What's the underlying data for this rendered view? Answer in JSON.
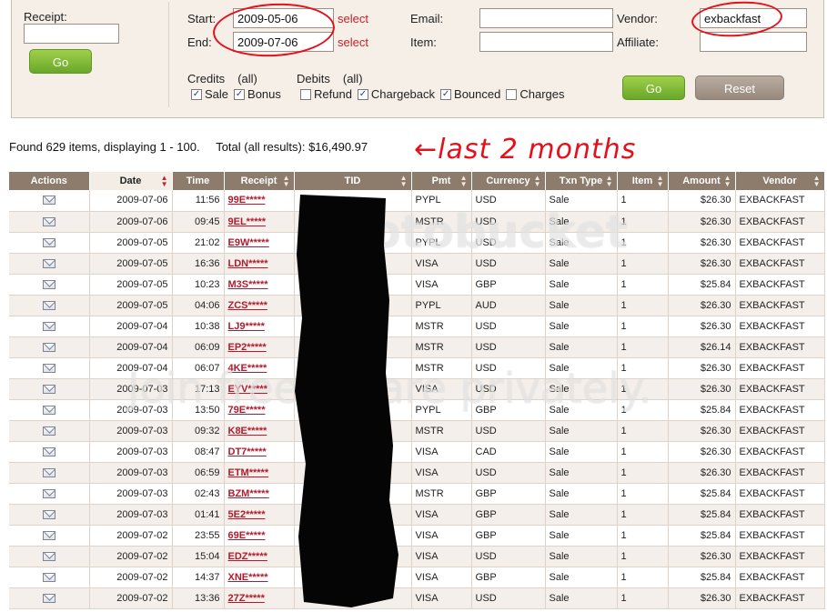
{
  "filters": {
    "receipt": {
      "label": "Receipt:",
      "value": ""
    },
    "start": {
      "label": "Start:",
      "value": "2009-05-06",
      "select_label": "select"
    },
    "end": {
      "label": "End:",
      "value": "2009-07-06",
      "select_label": "select"
    },
    "email": {
      "label": "Email:",
      "value": ""
    },
    "item": {
      "label": "Item:",
      "value": ""
    },
    "vendor": {
      "label": "Vendor:",
      "value": "exbackfast"
    },
    "affiliate": {
      "label": "Affiliate:",
      "value": ""
    },
    "go_left_label": "Go",
    "go_right_label": "Go",
    "reset_label": "Reset",
    "credits": {
      "title": "Credits",
      "all": "(all)",
      "options": [
        {
          "label": "Sale",
          "checked": true
        },
        {
          "label": "Bonus",
          "checked": true
        }
      ]
    },
    "debits": {
      "title": "Debits",
      "all": "(all)",
      "options": [
        {
          "label": "Refund",
          "checked": false
        },
        {
          "label": "Chargeback",
          "checked": true
        },
        {
          "label": "Bounced",
          "checked": true
        },
        {
          "label": "Charges",
          "checked": false
        }
      ]
    }
  },
  "summary": {
    "found": "Found 629 items, displaying 1 - 100.",
    "total": "Total (all results): $16,490.97"
  },
  "annotation": "←last 2 months",
  "watermark": {
    "logo": "photobucket",
    "tagline": "Join free. Share privately."
  },
  "table": {
    "headers": [
      "Actions",
      "Date",
      "Time",
      "Receipt",
      "TID",
      "Pmt",
      "Currency",
      "Txn Type",
      "Item",
      "Amount",
      "Vendor"
    ],
    "rows": [
      [
        "2009-07-06",
        "11:56",
        "99E*****",
        "PYPL",
        "USD",
        "Sale",
        "1",
        "$26.30",
        "EXBACKFAST"
      ],
      [
        "2009-07-06",
        "09:45",
        "9EL*****",
        "MSTR",
        "USD",
        "Sale",
        "1",
        "$26.30",
        "EXBACKFAST"
      ],
      [
        "2009-07-05",
        "21:02",
        "E9W*****",
        "PYPL",
        "USD",
        "Sale",
        "1",
        "$26.30",
        "EXBACKFAST"
      ],
      [
        "2009-07-05",
        "16:36",
        "LDN*****",
        "VISA",
        "USD",
        "Sale",
        "1",
        "$26.30",
        "EXBACKFAST"
      ],
      [
        "2009-07-05",
        "10:23",
        "M3S*****",
        "VISA",
        "GBP",
        "Sale",
        "1",
        "$25.84",
        "EXBACKFAST"
      ],
      [
        "2009-07-05",
        "04:06",
        "ZCS*****",
        "PYPL",
        "AUD",
        "Sale",
        "1",
        "$26.30",
        "EXBACKFAST"
      ],
      [
        "2009-07-04",
        "10:38",
        "LJ9*****",
        "MSTR",
        "USD",
        "Sale",
        "1",
        "$26.30",
        "EXBACKFAST"
      ],
      [
        "2009-07-04",
        "06:09",
        "EP2*****",
        "MSTR",
        "USD",
        "Sale",
        "1",
        "$26.14",
        "EXBACKFAST"
      ],
      [
        "2009-07-04",
        "06:07",
        "4KE*****",
        "MSTR",
        "USD",
        "Sale",
        "1",
        "$26.30",
        "EXBACKFAST"
      ],
      [
        "2009-07-03",
        "17:13",
        "EYV*****",
        "VISA",
        "USD",
        "Sale",
        "1",
        "$26.30",
        "EXBACKFAST"
      ],
      [
        "2009-07-03",
        "13:50",
        "79E*****",
        "PYPL",
        "GBP",
        "Sale",
        "1",
        "$25.84",
        "EXBACKFAST"
      ],
      [
        "2009-07-03",
        "09:32",
        "K8E*****",
        "MSTR",
        "USD",
        "Sale",
        "1",
        "$26.30",
        "EXBACKFAST"
      ],
      [
        "2009-07-03",
        "08:47",
        "DT7*****",
        "VISA",
        "CAD",
        "Sale",
        "1",
        "$26.30",
        "EXBACKFAST"
      ],
      [
        "2009-07-03",
        "06:59",
        "ETM*****",
        "VISA",
        "USD",
        "Sale",
        "1",
        "$26.30",
        "EXBACKFAST"
      ],
      [
        "2009-07-03",
        "02:43",
        "BZM*****",
        "MSTR",
        "GBP",
        "Sale",
        "1",
        "$25.84",
        "EXBACKFAST"
      ],
      [
        "2009-07-03",
        "01:41",
        "5E2*****",
        "VISA",
        "GBP",
        "Sale",
        "1",
        "$25.84",
        "EXBACKFAST"
      ],
      [
        "2009-07-02",
        "23:55",
        "69E*****",
        "VISA",
        "GBP",
        "Sale",
        "1",
        "$25.84",
        "EXBACKFAST"
      ],
      [
        "2009-07-02",
        "15:04",
        "EDZ*****",
        "VISA",
        "USD",
        "Sale",
        "1",
        "$26.30",
        "EXBACKFAST"
      ],
      [
        "2009-07-02",
        "14:37",
        "XNE*****",
        "VISA",
        "GBP",
        "Sale",
        "1",
        "$25.84",
        "EXBACKFAST"
      ],
      [
        "2009-07-02",
        "13:36",
        "27Z*****",
        "VISA",
        "USD",
        "Sale",
        "1",
        "$26.30",
        "EXBACKFAST"
      ]
    ]
  }
}
